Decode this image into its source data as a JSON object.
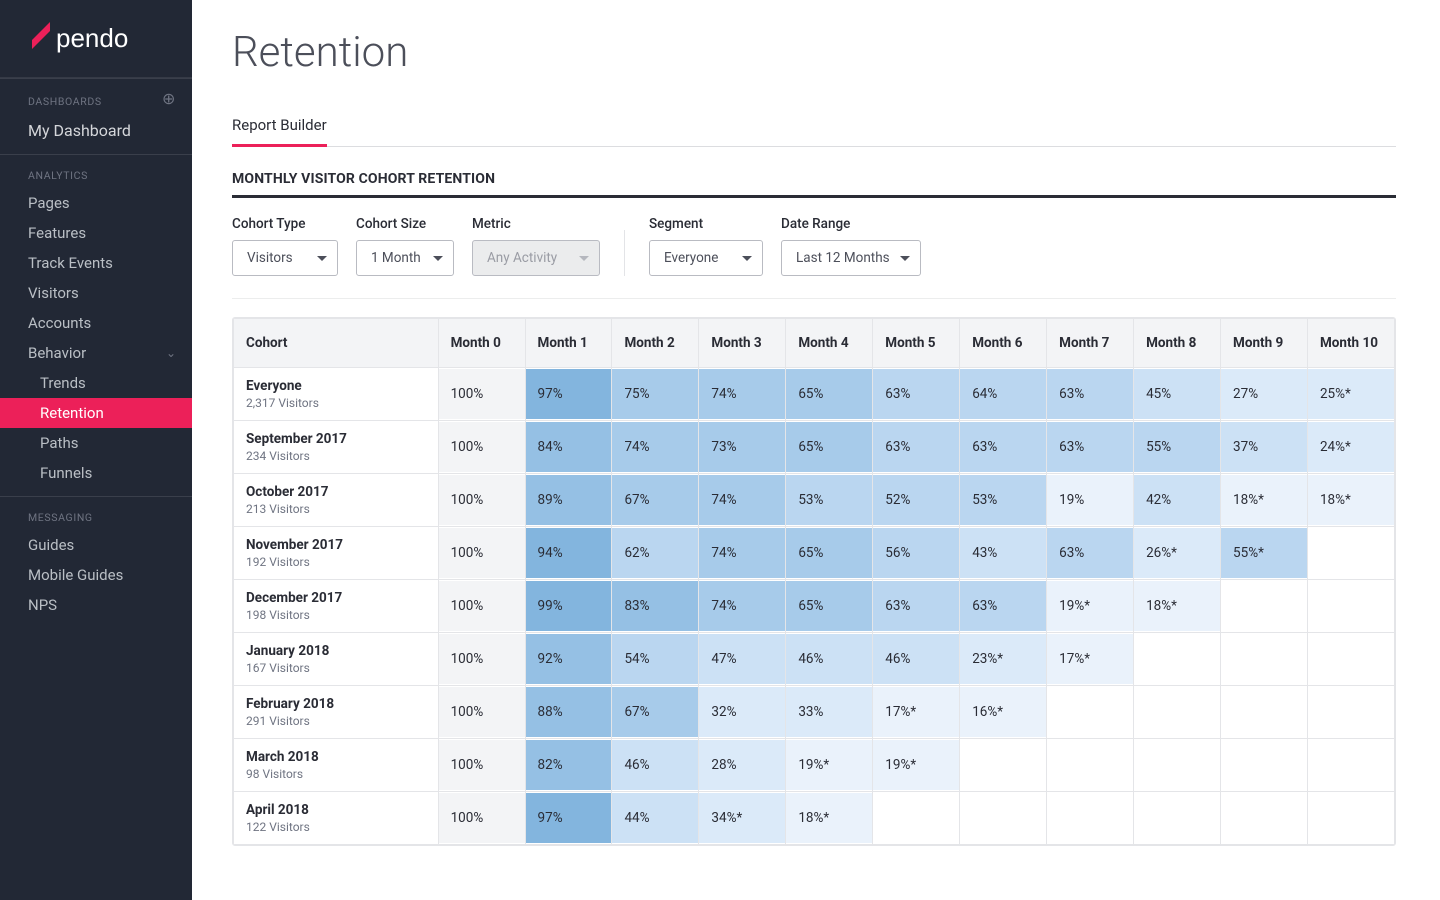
{
  "brand": "pendo",
  "sidebar": {
    "dashboards_heading": "DASHBOARDS",
    "my_dashboard": "My Dashboard",
    "analytics_heading": "ANALYTICS",
    "analytics_items": [
      "Pages",
      "Features",
      "Track Events",
      "Visitors",
      "Accounts"
    ],
    "behavior_label": "Behavior",
    "behavior_items": [
      "Trends",
      "Retention",
      "Paths",
      "Funnels"
    ],
    "behavior_active_index": 1,
    "messaging_heading": "MESSAGING",
    "messaging_items": [
      "Guides",
      "Mobile Guides",
      "NPS"
    ]
  },
  "page_title": "Retention",
  "tab_label": "Report Builder",
  "section_title": "MONTHLY VISITOR COHORT RETENTION",
  "controls": {
    "cohort_type": {
      "label": "Cohort Type",
      "value": "Visitors"
    },
    "cohort_size": {
      "label": "Cohort Size",
      "value": "1 Month"
    },
    "metric": {
      "label": "Metric",
      "value": "Any Activity"
    },
    "segment": {
      "label": "Segment",
      "value": "Everyone"
    },
    "date_range": {
      "label": "Date Range",
      "value": "Last 12 Months"
    }
  },
  "colors": {
    "accent": "#ec2059",
    "heat_scale": [
      "#f6fafe",
      "#eaf2fb",
      "#dbeaf9",
      "#cce1f5",
      "#bad6f0",
      "#a7cbea",
      "#95c0e4",
      "#83b5de"
    ]
  },
  "chart_data": {
    "type": "heatmap",
    "title": "Monthly Visitor Cohort Retention",
    "columns": [
      "Cohort",
      "Month 0",
      "Month 1",
      "Month 2",
      "Month 3",
      "Month 4",
      "Month 5",
      "Month 6",
      "Month 7",
      "Month 8",
      "Month 9",
      "Month 10"
    ],
    "rows": [
      {
        "cohort": "Everyone",
        "visitors": "2,317 Visitors",
        "values": [
          "100%",
          "97%",
          "75%",
          "74%",
          "65%",
          "63%",
          "64%",
          "63%",
          "45%",
          "27%",
          "25%*"
        ]
      },
      {
        "cohort": "September 2017",
        "visitors": "234 Visitors",
        "values": [
          "100%",
          "84%",
          "74%",
          "73%",
          "65%",
          "63%",
          "63%",
          "63%",
          "55%",
          "37%",
          "24%*"
        ]
      },
      {
        "cohort": "October 2017",
        "visitors": "213 Visitors",
        "values": [
          "100%",
          "89%",
          "67%",
          "74%",
          "53%",
          "52%",
          "53%",
          "19%",
          "42%",
          "18%*",
          "18%*"
        ]
      },
      {
        "cohort": "November 2017",
        "visitors": "192 Visitors",
        "values": [
          "100%",
          "94%",
          "62%",
          "74%",
          "65%",
          "56%",
          "43%",
          "63%",
          "26%*",
          "55%*",
          ""
        ]
      },
      {
        "cohort": "December 2017",
        "visitors": "198 Visitors",
        "values": [
          "100%",
          "99%",
          "83%",
          "74%",
          "65%",
          "63%",
          "63%",
          "19%*",
          "18%*",
          "",
          ""
        ]
      },
      {
        "cohort": "January 2018",
        "visitors": "167 Visitors",
        "values": [
          "100%",
          "92%",
          "54%",
          "47%",
          "46%",
          "46%",
          "23%*",
          "17%*",
          "",
          "",
          ""
        ]
      },
      {
        "cohort": "February 2018",
        "visitors": "291 Visitors",
        "values": [
          "100%",
          "88%",
          "67%",
          "32%",
          "33%",
          "17%*",
          "16%*",
          "",
          "",
          "",
          ""
        ]
      },
      {
        "cohort": "March 2018",
        "visitors": "98 Visitors",
        "values": [
          "100%",
          "82%",
          "46%",
          "28%",
          "19%*",
          "19%*",
          "",
          "",
          "",
          "",
          ""
        ]
      },
      {
        "cohort": "April 2018",
        "visitors": "122 Visitors",
        "values": [
          "100%",
          "97%",
          "44%",
          "34%*",
          "18%*",
          "",
          "",
          "",
          "",
          "",
          ""
        ]
      }
    ]
  }
}
